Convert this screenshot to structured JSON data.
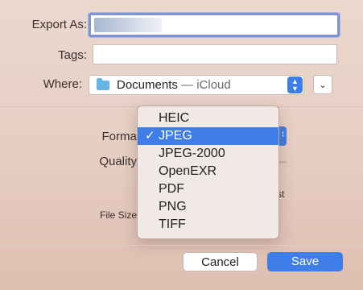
{
  "export_as": {
    "label": "Export As:",
    "value": ""
  },
  "tags": {
    "label": "Tags:",
    "value": ""
  },
  "where": {
    "label": "Where:",
    "location": "Documents",
    "service": "— iCloud"
  },
  "format": {
    "label": "Format"
  },
  "quality": {
    "label": "Quality"
  },
  "file_size": {
    "label": "File Size"
  },
  "partial_text": "st",
  "format_menu": {
    "selected": "JPEG",
    "options": [
      "HEIC",
      "JPEG",
      "JPEG-2000",
      "OpenEXR",
      "PDF",
      "PNG",
      "TIFF"
    ]
  },
  "buttons": {
    "cancel": "Cancel",
    "save": "Save"
  },
  "icons": {
    "folder": "folder-icon",
    "stepper": "up-down-chevron-icon",
    "expand": "chevron-down-icon",
    "check": "checkmark-icon"
  },
  "colors": {
    "accent": "#3f7ee8",
    "focus_ring": "#7f94d1",
    "folder": "#67b4e6"
  }
}
